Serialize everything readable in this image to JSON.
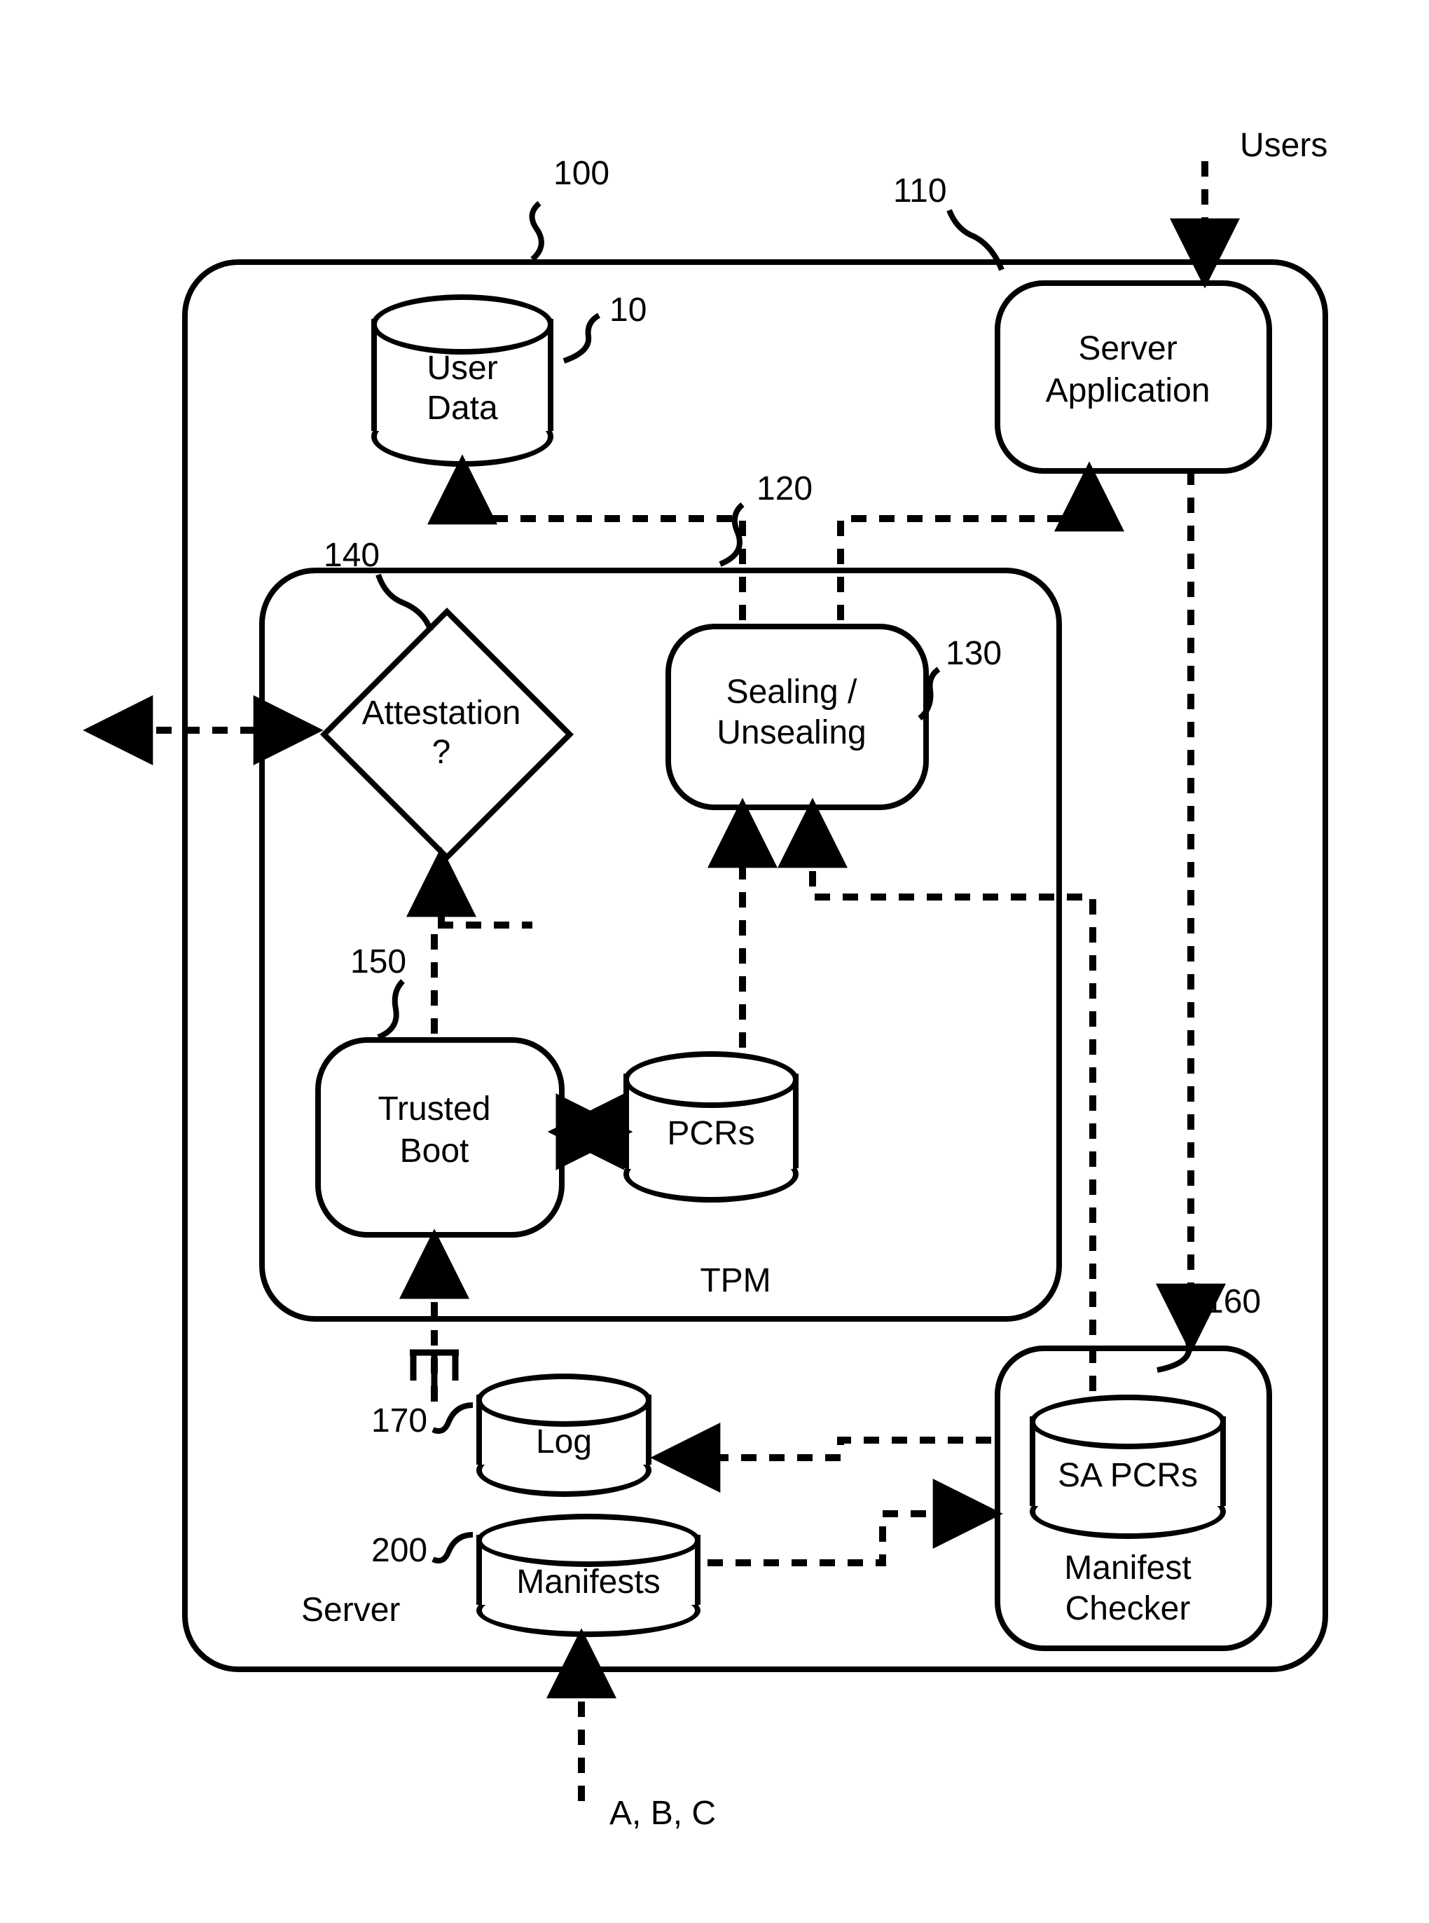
{
  "labels": {
    "users": "Users",
    "ref100": "100",
    "ref110": "110",
    "ref10": "10",
    "ref120": "120",
    "ref140": "140",
    "ref130": "130",
    "ref150": "150",
    "ref160": "160",
    "ref170": "170",
    "ref200": "200",
    "abc": "A, B, C"
  },
  "blocks": {
    "userData1": "User",
    "userData2": "Data",
    "serverApp1": "Server",
    "serverApp2": "Application",
    "attest1": "Attestation",
    "attest2": "?",
    "sealing1": "Sealing /",
    "sealing2": "Unsealing",
    "trusted1": "Trusted",
    "trusted2": "Boot",
    "pcrs": "PCRs",
    "tpm": "TPM",
    "log": "Log",
    "manifests": "Manifests",
    "sapcrs": "SA PCRs",
    "manifestChecker1": "Manifest",
    "manifestChecker2": "Checker",
    "server": "Server"
  },
  "diagram": {
    "type": "block-diagram",
    "nodes": [
      {
        "id": "100",
        "label": "Server (outer container)",
        "kind": "container"
      },
      {
        "id": "10",
        "label": "User Data",
        "kind": "datastore"
      },
      {
        "id": "110",
        "label": "Server Application",
        "kind": "process"
      },
      {
        "id": "120",
        "label": "TPM (container)",
        "kind": "container"
      },
      {
        "id": "140",
        "label": "Attestation ?",
        "kind": "decision"
      },
      {
        "id": "130",
        "label": "Sealing / Unsealing",
        "kind": "process"
      },
      {
        "id": "150",
        "label": "Trusted Boot",
        "kind": "process"
      },
      {
        "id": "PCRs",
        "label": "PCRs",
        "kind": "datastore"
      },
      {
        "id": "170",
        "label": "Log",
        "kind": "datastore"
      },
      {
        "id": "200",
        "label": "Manifests",
        "kind": "datastore"
      },
      {
        "id": "160",
        "label": "Manifest Checker",
        "kind": "process-container"
      },
      {
        "id": "SAPCRs",
        "label": "SA PCRs",
        "kind": "datastore"
      },
      {
        "id": "Users",
        "label": "Users",
        "kind": "external"
      },
      {
        "id": "ABC",
        "label": "A, B, C",
        "kind": "external"
      }
    ],
    "edges": [
      {
        "from": "Users",
        "to": "110",
        "style": "dashed"
      },
      {
        "from": "130",
        "to": "10",
        "style": "dashed"
      },
      {
        "from": "130",
        "to": "110",
        "style": "dashed"
      },
      {
        "from": "110",
        "to": "130",
        "style": "dashed"
      },
      {
        "from": "140",
        "to": "external-left",
        "style": "dashed-bidir"
      },
      {
        "from": "150",
        "to": "140",
        "style": "dashed-elbow"
      },
      {
        "from": "PCRs",
        "to": "130",
        "style": "dashed"
      },
      {
        "from": "150",
        "to": "PCRs",
        "style": "solid-bidir"
      },
      {
        "from": "170",
        "to": "150",
        "style": "dashed-branch"
      },
      {
        "from": "160",
        "to": "170",
        "style": "dashed"
      },
      {
        "from": "200",
        "to": "160",
        "style": "dashed"
      },
      {
        "from": "110",
        "to": "160",
        "style": "dashed"
      },
      {
        "from": "160",
        "to": "130",
        "style": "dashed"
      },
      {
        "from": "ABC",
        "to": "200",
        "style": "dashed"
      }
    ]
  }
}
